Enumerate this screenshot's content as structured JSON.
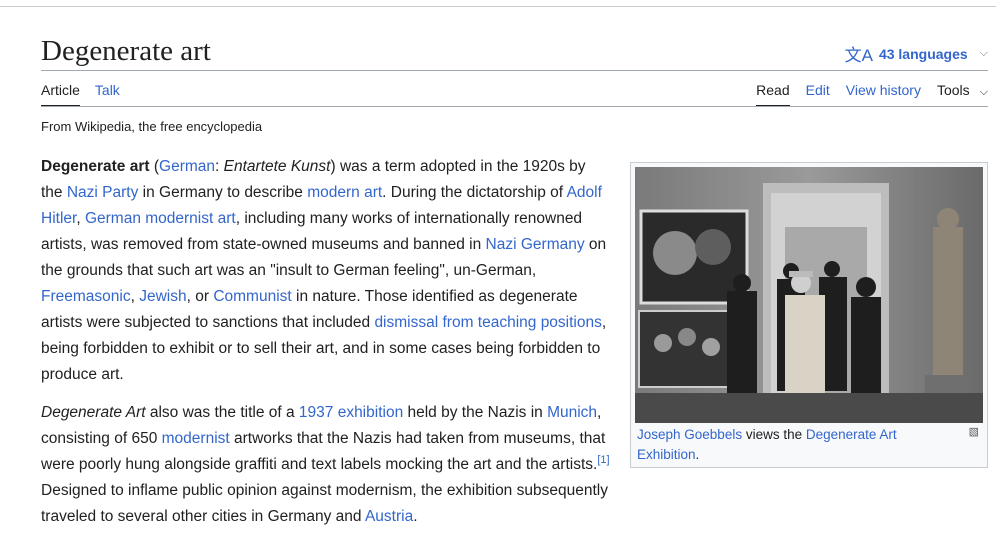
{
  "header": {
    "title": "Degenerate art",
    "languages_label": "43 languages"
  },
  "tabs": {
    "article": "Article",
    "talk": "Talk",
    "read": "Read",
    "edit": "Edit",
    "view_history": "View history",
    "tools": "Tools"
  },
  "tagline": "From Wikipedia, the free encyclopedia",
  "para1": {
    "t0": "Degenerate art",
    "t1": " (",
    "l_german": "German",
    "t2": ": ",
    "t3": "Entartete Kunst",
    "t4": ") was a term adopted in the 1920s by the ",
    "l_nazi_party": "Nazi Party",
    "t5": " in Germany to describe ",
    "l_modern_art": "modern art",
    "t6": ". During the dictatorship of ",
    "l_hitler": "Adolf Hitler",
    "t7": ", ",
    "l_modernist_art": "German modernist art",
    "t8": ", including many works of internationally renowned artists, was removed from state-owned museums and banned in ",
    "l_nazi_germany": "Nazi Germany",
    "t9": " on the grounds that such art was an \"insult to German feeling\", un-German, ",
    "l_freemasonic": "Freemasonic",
    "t10": ", ",
    "l_jewish": "Jewish",
    "t11": ", or ",
    "l_communist": "Communist",
    "t12": " in nature. Those identified as degenerate artists were subjected to sanctions that included ",
    "l_dismissal": "dismissal from teaching positions",
    "t13": ", being forbidden to exhibit or to sell their art, and in some cases being forbidden to produce art."
  },
  "para2": {
    "t0": "Degenerate Art",
    "t1": " also was the title of a ",
    "l_exhibition": "1937 exhibition",
    "t2": " held by the Nazis in ",
    "l_munich": "Munich",
    "t3": ", consisting of 650 ",
    "l_modernist": "modernist",
    "t4": " artworks that the Nazis had taken from museums, that were poorly hung alongside graffiti and text labels mocking the art and the artists.",
    "ref": "[1]",
    "t5": " Designed to inflame public opinion against modernism, the exhibition subsequently traveled to several other cities in Germany and ",
    "l_austria": "Austria",
    "t6": "."
  },
  "figure": {
    "l_goebbels": "Joseph Goebbels",
    "t1": " views the ",
    "l_exhibition": "Degenerate Art Exhibition",
    "t2": "."
  }
}
